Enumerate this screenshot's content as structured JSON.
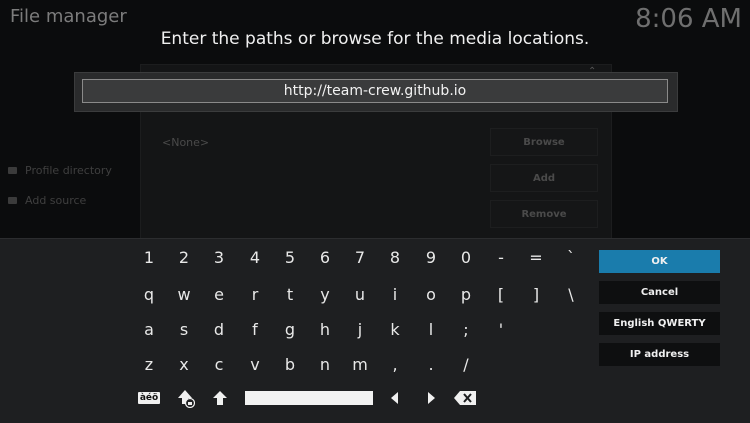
{
  "app": {
    "title": "File manager",
    "clock": "8:06 AM"
  },
  "background": {
    "sidebar": [
      "Profile directory",
      "Add source"
    ],
    "list_empty": "<None>",
    "buttons": [
      "Browse",
      "Add",
      "Remove"
    ]
  },
  "dialog": {
    "heading": "Enter the paths or browse for the media locations.",
    "input_value": "http://team-crew.github.io"
  },
  "keyboard": {
    "rows": [
      [
        "1",
        "2",
        "3",
        "4",
        "5",
        "6",
        "7",
        "8",
        "9",
        "0",
        "-",
        "=",
        "`"
      ],
      [
        "q",
        "w",
        "e",
        "r",
        "t",
        "y",
        "u",
        "i",
        "o",
        "p",
        "[",
        "]",
        "\\"
      ],
      [
        "a",
        "s",
        "d",
        "f",
        "g",
        "h",
        "j",
        "k",
        "l",
        ";",
        "'"
      ],
      [
        "z",
        "x",
        "c",
        "v",
        "b",
        "n",
        "m",
        ",",
        ".",
        "/"
      ]
    ],
    "accent_label": "àéö",
    "side_buttons": [
      "OK",
      "Cancel",
      "English QWERTY",
      "IP address"
    ],
    "focused_button": "OK",
    "icons": [
      "accent-icon",
      "shift-lock-icon",
      "shift-icon",
      "spacebar",
      "arrow-left-icon",
      "arrow-right-icon",
      "backspace-icon"
    ]
  },
  "colors": {
    "focus": "#1a7cac",
    "panel": "#1e1f21",
    "background": "#0b0c0d"
  }
}
